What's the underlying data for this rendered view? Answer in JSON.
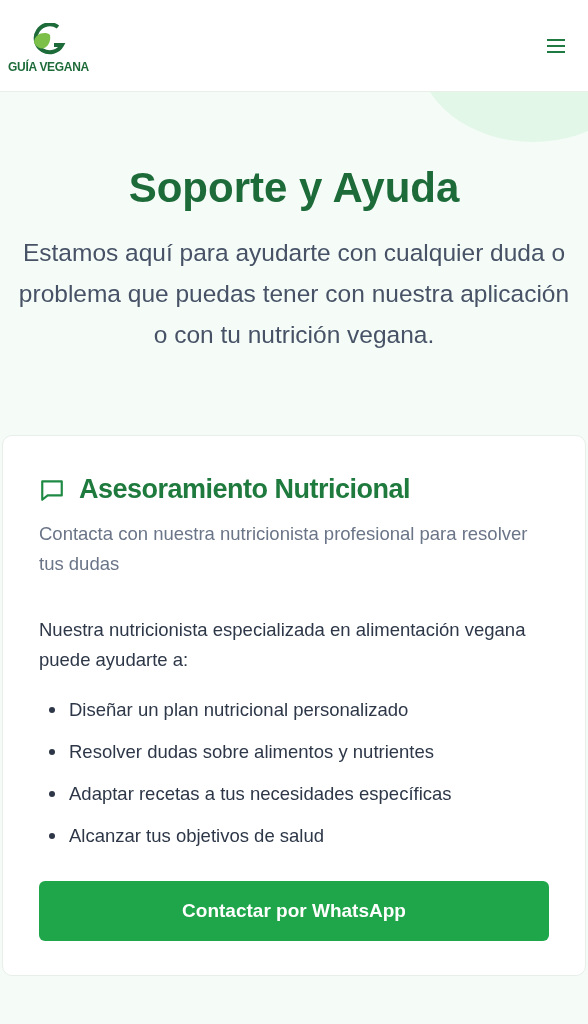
{
  "header": {
    "logo_text": "GUÍA VEGANA"
  },
  "hero": {
    "title": "Soporte y Ayuda",
    "subtitle": "Estamos aquí para ayudarte con cualquier duda o problema que puedas tener con nuestra aplicación o con tu nutrición vegana."
  },
  "card": {
    "title": "Asesoramiento Nutricional",
    "description": "Contacta con nuestra nutricionista profesional para resolver tus dudas",
    "intro": "Nuestra nutricionista especializada en alimentación vegana puede ayudarte a:",
    "items": [
      "Diseñar un plan nutricional personalizado",
      "Resolver dudas sobre alimentos y nutrientes",
      "Adaptar recetas a tus necesidades específicas",
      "Alcanzar tus objetivos de salud"
    ],
    "button": "Contactar por WhatsApp"
  }
}
